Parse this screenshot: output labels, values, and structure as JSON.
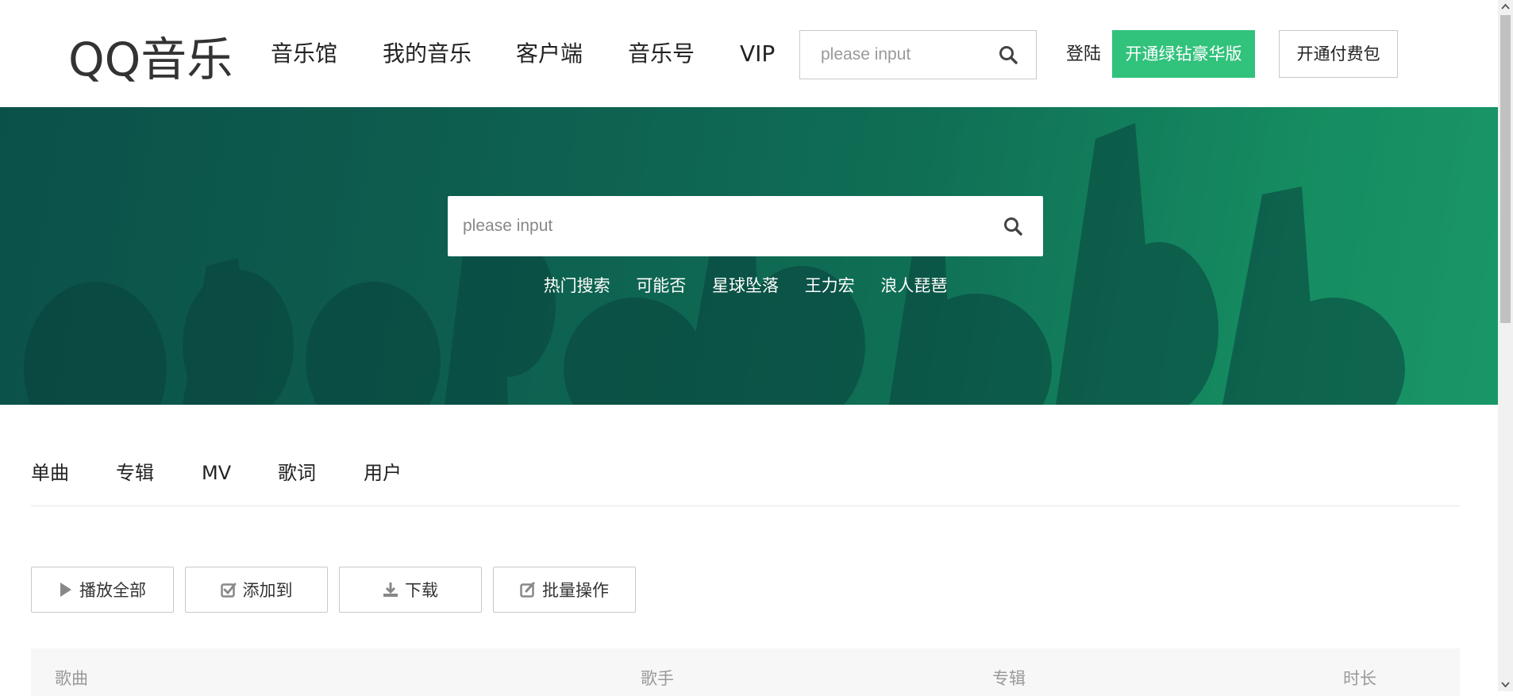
{
  "header": {
    "logo": "QQ音乐",
    "nav": [
      "音乐馆",
      "我的音乐",
      "客户端",
      "音乐号",
      "VIP"
    ],
    "search_placeholder": "please input",
    "login": "登陆",
    "vip_button": "开通绿钻豪华版",
    "pay_button": "开通付费包"
  },
  "banner": {
    "search_placeholder": "please input",
    "hot_label": "热门搜索",
    "hot_items": [
      "可能否",
      "星球坠落",
      "王力宏",
      "浪人琵琶"
    ]
  },
  "tabs": [
    "单曲",
    "专辑",
    "MV",
    "歌词",
    "用户"
  ],
  "actions": [
    {
      "label": "播放全部",
      "icon": "play-icon"
    },
    {
      "label": "添加到",
      "icon": "checkbox-icon"
    },
    {
      "label": "下载",
      "icon": "download-icon"
    },
    {
      "label": "批量操作",
      "icon": "edit-icon"
    }
  ],
  "table": {
    "columns": [
      "歌曲",
      "歌手",
      "专辑",
      "时长"
    ]
  },
  "colors": {
    "accent": "#31c27c",
    "banner_dark": "#0f5d55",
    "banner_light": "#24c883"
  }
}
